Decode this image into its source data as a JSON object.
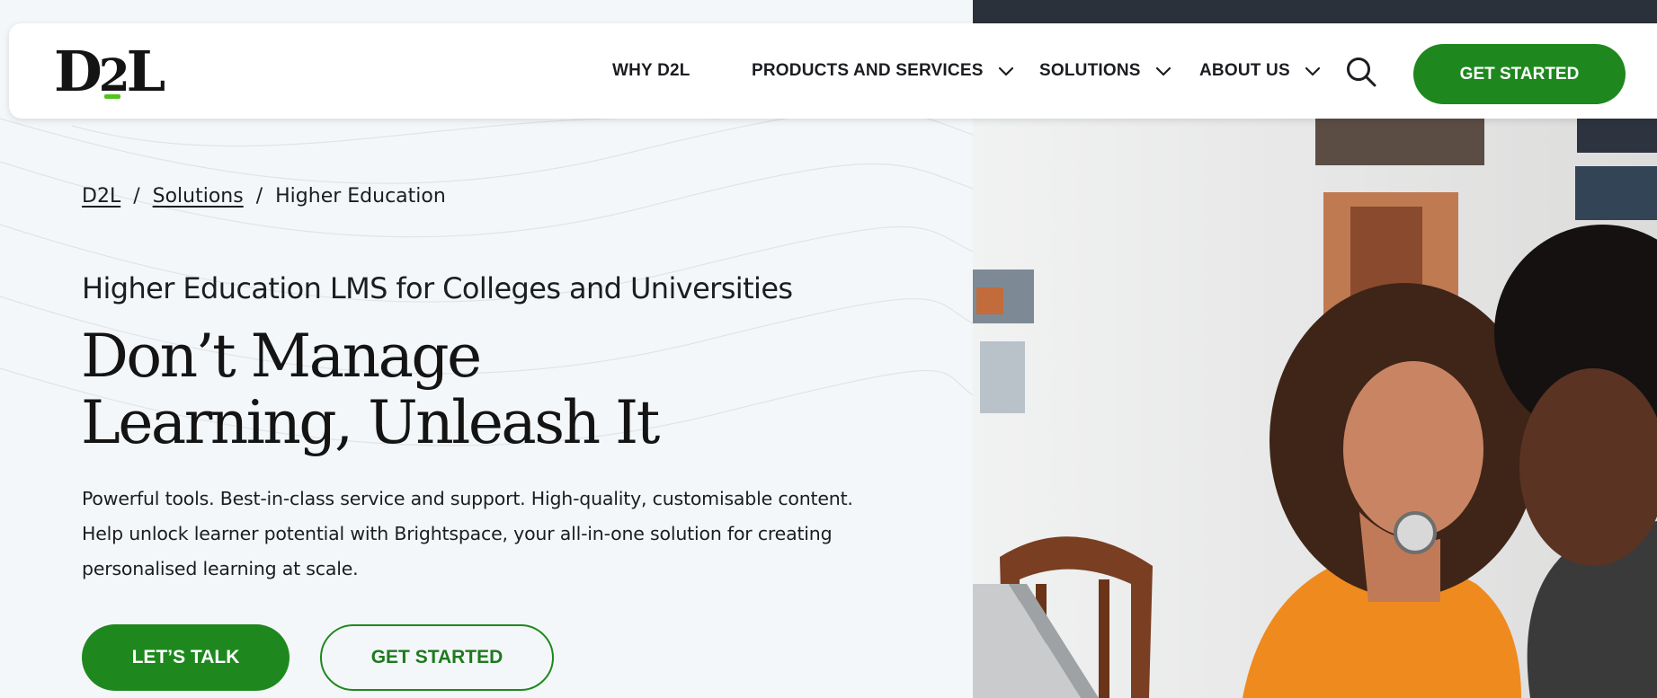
{
  "brand": {
    "logo_text_left": "D",
    "logo_text_mid": "2",
    "logo_text_right": "L",
    "accent_green": "#1e881e",
    "logo_underline": "#52c31e"
  },
  "nav": {
    "items": [
      {
        "label": "WHY D2L",
        "has_dropdown": false
      },
      {
        "label": "PRODUCTS AND SERVICES",
        "has_dropdown": true
      },
      {
        "label": "SOLUTIONS",
        "has_dropdown": true
      },
      {
        "label": "ABOUT US",
        "has_dropdown": true
      }
    ],
    "search_icon": "search-icon",
    "cta_label": "GET STARTED"
  },
  "breadcrumb": {
    "items": [
      "D2L",
      "Solutions",
      "Higher Education"
    ],
    "separator": "/"
  },
  "hero": {
    "eyebrow": "Higher Education LMS for Colleges and Universities",
    "headline_line1": "Don’t Manage",
    "headline_line2": "Learning, Unleash It",
    "body_line1": "Powerful tools. Best-in-class service and support. High-quality, customisable content.",
    "body_line2": "Help unlock learner potential with Brightspace, your all-in-one solution for creating",
    "body_line3": "personalised learning at scale.",
    "primary_button": "LET’S TALK",
    "secondary_button": "GET STARTED"
  }
}
